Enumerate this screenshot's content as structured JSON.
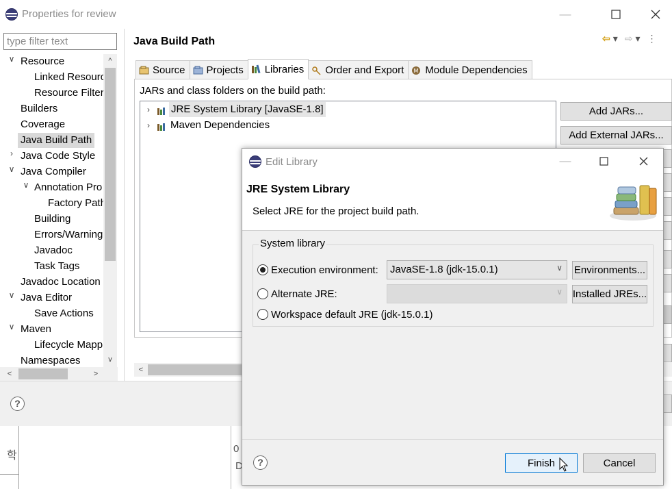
{
  "window": {
    "title": "Properties for review",
    "filter_placeholder": "type filter text"
  },
  "tree": {
    "items": [
      {
        "label": "Resource",
        "chevron": "v"
      },
      {
        "label": "Linked Resourc"
      },
      {
        "label": "Resource Filter"
      },
      {
        "label": "Builders"
      },
      {
        "label": "Coverage"
      },
      {
        "label": "Java Build Path"
      },
      {
        "label": "Java Code Style",
        "chevron": ">"
      },
      {
        "label": "Java Compiler",
        "chevron": "v"
      },
      {
        "label": "Annotation Pro",
        "chevron": "v"
      },
      {
        "label": "Factory Path"
      },
      {
        "label": "Building"
      },
      {
        "label": "Errors/Warning"
      },
      {
        "label": "Javadoc"
      },
      {
        "label": "Task Tags"
      },
      {
        "label": "Javadoc Location"
      },
      {
        "label": "Java Editor",
        "chevron": "v"
      },
      {
        "label": "Save Actions"
      },
      {
        "label": "Maven",
        "chevron": "v"
      },
      {
        "label": "Lifecycle Mapp"
      },
      {
        "label": "Namespaces"
      }
    ]
  },
  "page": {
    "title": "Java Build Path",
    "tabs": [
      {
        "label": "Source"
      },
      {
        "label": "Projects"
      },
      {
        "label": "Libraries"
      },
      {
        "label": "Order and Export"
      },
      {
        "label": "Module Dependencies"
      }
    ],
    "jars_label": "JARs and class folders on the build path:",
    "libraries": [
      {
        "label": "JRE System Library [JavaSE-1.8]"
      },
      {
        "label": "Maven Dependencies"
      }
    ],
    "buttons": {
      "add_jars": "Add JARs...",
      "add_external_jars": "Add External JARs..."
    }
  },
  "dialog": {
    "title": "Edit Library",
    "header_title": "JRE System Library",
    "header_desc": "Select JRE for the project build path.",
    "group_label": "System library",
    "exec_env_label": "Execution environment:",
    "exec_env_value": "JavaSE-1.8 (jdk-15.0.1)",
    "environments_button": "Environments...",
    "alt_jre_label": "Alternate JRE:",
    "alt_jre_value": "",
    "installed_jres_button": "Installed JREs...",
    "workspace_default_label": "Workspace default JRE (jdk-15.0.1)",
    "finish_button": "Finish",
    "cancel_button": "Cancel"
  },
  "background": {
    "left_char": "학",
    "count_digit": "0",
    "d_char": "D"
  }
}
